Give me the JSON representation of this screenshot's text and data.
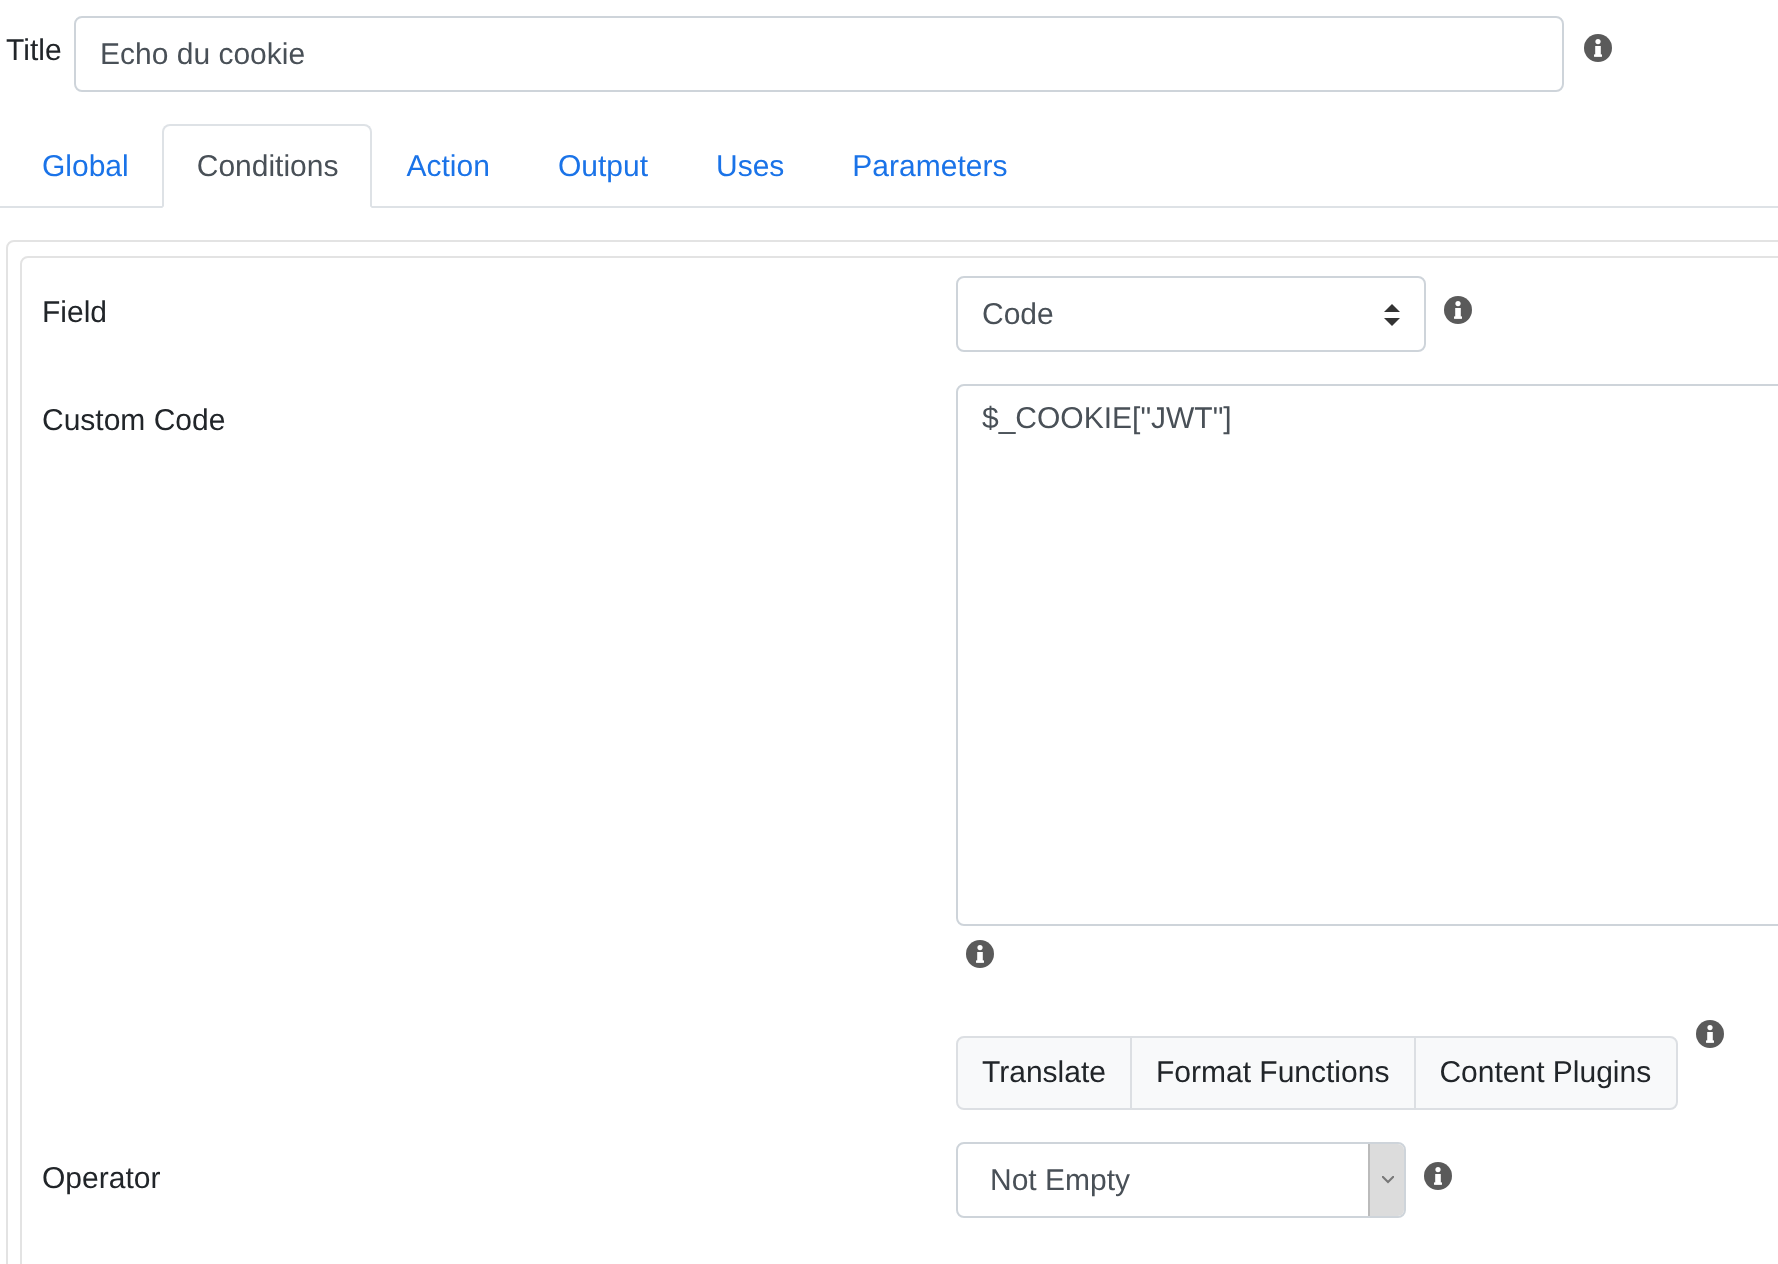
{
  "title": {
    "label": "Title",
    "value": "Echo du cookie"
  },
  "tabs": [
    {
      "label": "Global",
      "selected": false
    },
    {
      "label": "Conditions",
      "selected": true
    },
    {
      "label": "Action",
      "selected": false
    },
    {
      "label": "Output",
      "selected": false
    },
    {
      "label": "Uses",
      "selected": false
    },
    {
      "label": "Parameters",
      "selected": false
    }
  ],
  "fields": [
    {
      "kind": "select",
      "label": "Field",
      "value": "Code"
    },
    {
      "kind": "code",
      "label": "Custom Code",
      "value": "$_COOKIE[\"JWT\"]"
    },
    {
      "kind": "buttons",
      "buttons": [
        "Translate",
        "Format Functions",
        "Content Plugins"
      ]
    },
    {
      "kind": "combo",
      "label": "Operator",
      "value": "Not Empty"
    }
  ]
}
